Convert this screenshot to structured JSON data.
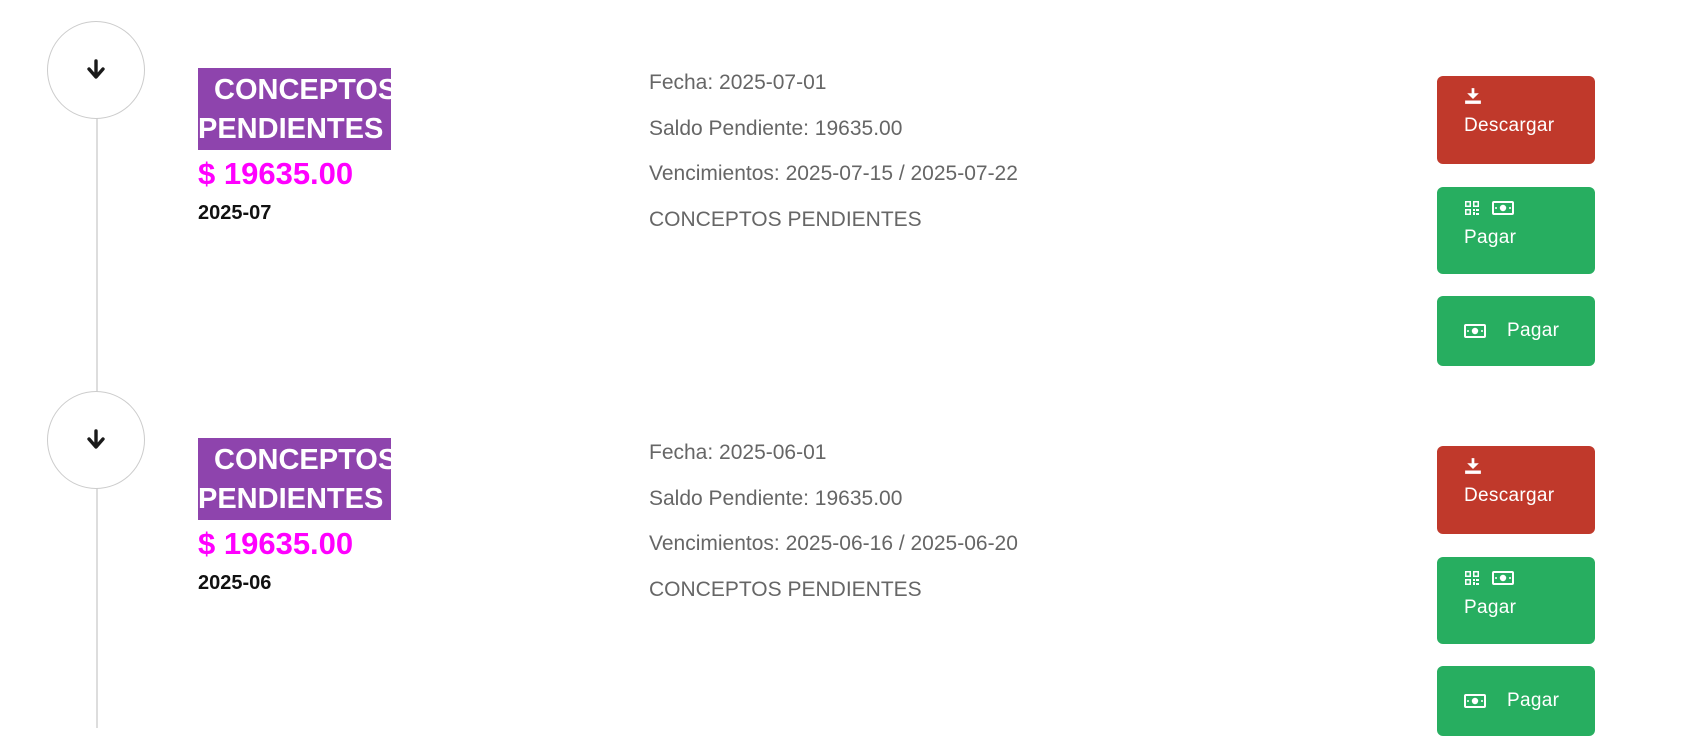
{
  "entries": [
    {
      "title_line1": "CONCEPTOS",
      "title_line2": "PENDIENTES",
      "amount": "$ 19635.00",
      "period": "2025-07",
      "details": {
        "fecha": "Fecha: 2025-07-01",
        "saldo": "Saldo Pendiente: 19635.00",
        "vencimientos": "Vencimientos: 2025-07-15 / 2025-07-22",
        "concepto": "CONCEPTOS PENDIENTES"
      },
      "buttons": {
        "download_label": "Descargar",
        "pay_qr_label": "Pagar",
        "pay_label": "Pagar"
      }
    },
    {
      "title_line1": "CONCEPTOS",
      "title_line2": "PENDIENTES",
      "amount": "$ 19635.00",
      "period": "2025-06",
      "details": {
        "fecha": "Fecha: 2025-06-01",
        "saldo": "Saldo Pendiente: 19635.00",
        "vencimientos": "Vencimientos: 2025-06-16 / 2025-06-20",
        "concepto": "CONCEPTOS PENDIENTES"
      },
      "buttons": {
        "download_label": "Descargar",
        "pay_qr_label": "Pagar",
        "pay_label": "Pagar"
      }
    }
  ],
  "icons": {
    "toggle": "arrow-down-icon",
    "download": "download-icon",
    "qr": "qr-code-icon",
    "money": "money-bill-icon"
  },
  "colors": {
    "badge": "#8e44ad",
    "amount": "#ff00ff",
    "download_button": "#c0392b",
    "pay_button": "#27ae60",
    "details_text": "#666666"
  }
}
